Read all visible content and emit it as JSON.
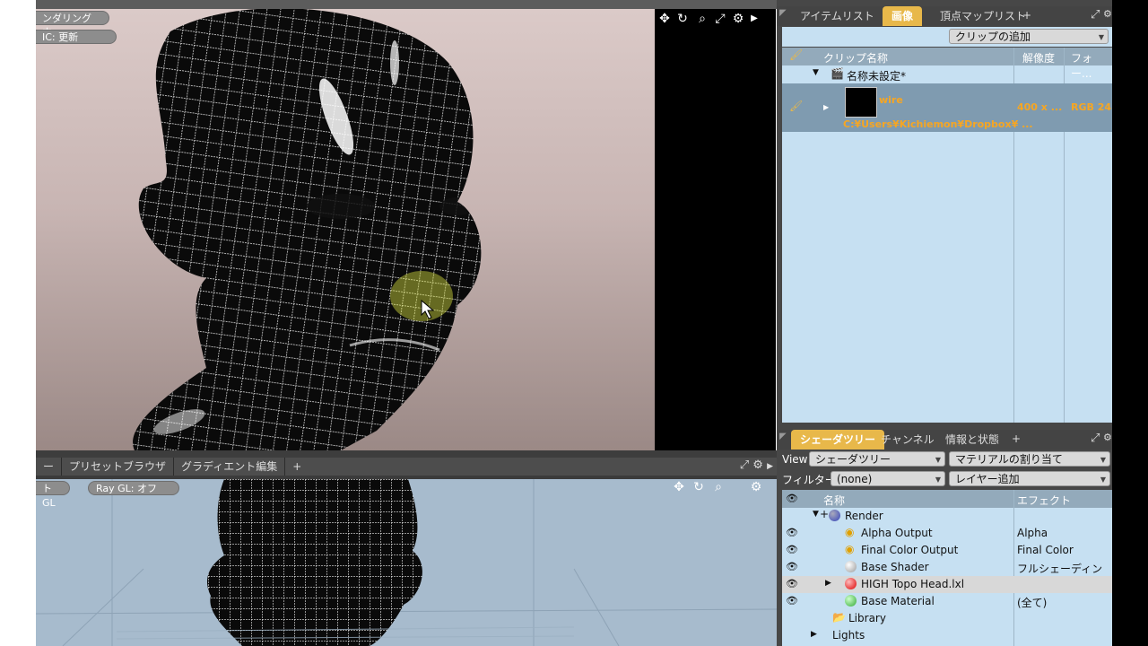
{
  "viewport_top": {
    "rendering_label": "ンダリング中...",
    "ic_label": "IC: 更新"
  },
  "viewport_bottom_tabs": [
    "ー",
    "プリセットブラウザ",
    "グラディエント編集"
  ],
  "viewport_bottom": {
    "gl_label": "ト GL",
    "raygl_label": "Ray GL: オフ"
  },
  "right_top_tabs": {
    "item_list": "アイテムリスト",
    "image": "画像",
    "vertex_map_list": "頂点マップリスト"
  },
  "clip_add_label": "クリップの追加",
  "clip_table": {
    "headers": [
      "クリップ名称",
      "解像度",
      "フォー..."
    ],
    "group_name": "名称未設定*",
    "clip": {
      "name": "wire",
      "resolution": "400 x ...",
      "format": "RGB 24",
      "path": "C:¥Users¥Kichiemon¥Dropbox¥ ..."
    }
  },
  "shader_tabs": {
    "shader_tree": "シェーダツリー",
    "channel": "チャンネル",
    "info": "情報と状態"
  },
  "shader_controls": {
    "view_label": "View",
    "view_value": "シェーダツリー",
    "assign_material": "マテリアルの割り当て",
    "filter_label": "フィルター",
    "filter_value": "(none)",
    "add_layer": "レイヤー追加"
  },
  "shader_table": {
    "headers": [
      "名称",
      "エフェクト"
    ],
    "rows": [
      {
        "name": "Render",
        "effect": ""
      },
      {
        "name": "Alpha Output",
        "effect": "Alpha"
      },
      {
        "name": "Final Color Output",
        "effect": "Final Color"
      },
      {
        "name": "Base Shader",
        "effect": "フルシェーディング"
      },
      {
        "name": "HIGH Topo Head.lxl",
        "effect": ""
      },
      {
        "name": "Base Material",
        "effect": "(全て)"
      },
      {
        "name": "Library",
        "effect": ""
      },
      {
        "name": "Lights",
        "effect": ""
      }
    ]
  },
  "colors": {
    "accent": "#e8b84a",
    "panel_bg": "#c6e0f2",
    "header_bg": "#93aabb",
    "selected_row": "#7f9bb0"
  }
}
